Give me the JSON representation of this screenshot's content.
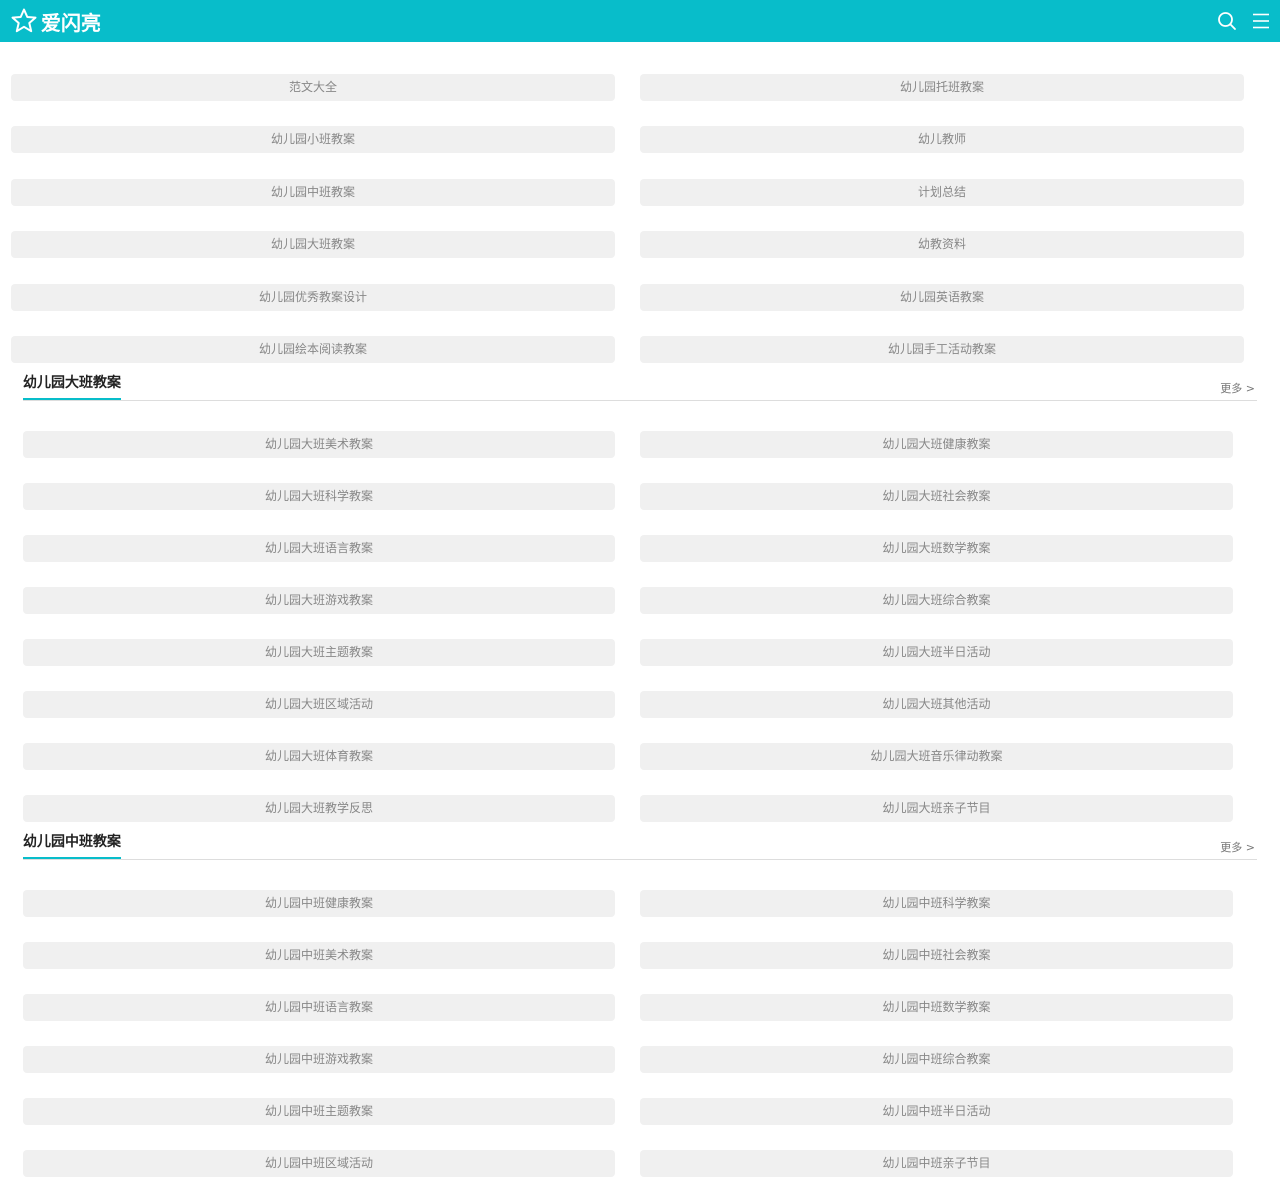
{
  "header": {
    "logo_text": "爱闪亮",
    "logo_icon": "star-icon",
    "search_icon": "search-icon",
    "menu_icon": "menu-icon",
    "accent_color": "#08bdca"
  },
  "top_nav": {
    "items": [
      "范文大全",
      "幼儿园托班教案",
      "幼儿园小班教案",
      "幼儿教师",
      "幼儿园中班教案",
      "计划总结",
      "幼儿园大班教案",
      "幼教资料",
      "幼儿园优秀教案设计",
      "幼儿园英语教案",
      "幼儿园绘本阅读教案",
      "幼儿园手工活动教案"
    ]
  },
  "sections": [
    {
      "title": "幼儿园大班教案",
      "more": "更多 >",
      "items": [
        "幼儿园大班美术教案",
        "幼儿园大班健康教案",
        "幼儿园大班科学教案",
        "幼儿园大班社会教案",
        "幼儿园大班语言教案",
        "幼儿园大班数学教案",
        "幼儿园大班游戏教案",
        "幼儿园大班综合教案",
        "幼儿园大班主题教案",
        "幼儿园大班半日活动",
        "幼儿园大班区域活动",
        "幼儿园大班其他活动",
        "幼儿园大班体育教案",
        "幼儿园大班音乐律动教案",
        "幼儿园大班教学反思",
        "幼儿园大班亲子节目"
      ]
    },
    {
      "title": "幼儿园中班教案",
      "more": "更多 >",
      "items": [
        "幼儿园中班健康教案",
        "幼儿园中班科学教案",
        "幼儿园中班美术教案",
        "幼儿园中班社会教案",
        "幼儿园中班语言教案",
        "幼儿园中班数学教案",
        "幼儿园中班游戏教案",
        "幼儿园中班综合教案",
        "幼儿园中班主题教案",
        "幼儿园中班半日活动",
        "幼儿园中班区域活动",
        "幼儿园中班亲子节目"
      ]
    }
  ]
}
